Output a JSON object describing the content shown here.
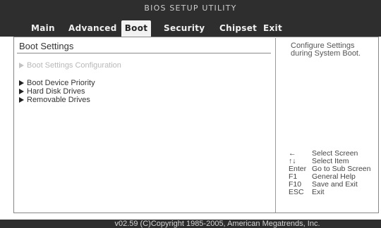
{
  "title": "BIOS SETUP UTILITY",
  "menu": {
    "main": "Main",
    "advanced": "Advanced",
    "boot": "Boot",
    "security": "Security",
    "chipset": "Chipset",
    "exit": "Exit"
  },
  "section_title": "Boot Settings",
  "entries": {
    "boot_settings_config": "Boot Settings Configuration",
    "boot_device_priority": "Boot Device Priority",
    "hard_disk_drives": "Hard Disk Drives",
    "removable_drives": "Removable Drives"
  },
  "help": {
    "line1": "Configure Settings",
    "line2": "during System Boot."
  },
  "keys": [
    {
      "key": "←",
      "desc": "Select Screen"
    },
    {
      "key": "↑↓",
      "desc": "Select Item"
    },
    {
      "key": "Enter",
      "desc": "Go to Sub Screen"
    },
    {
      "key": "F1",
      "desc": "General Help"
    },
    {
      "key": "F10",
      "desc": "Save and Exit"
    },
    {
      "key": "ESC",
      "desc": "Exit"
    }
  ],
  "footer": "v02.59 (C)Copyright 1985-2005, American Megatrends, Inc.",
  "colors": {
    "bar_background": "#2e2e2e",
    "active_tab": "#f2f2f2",
    "disabled_text": "#b8b8b8"
  }
}
